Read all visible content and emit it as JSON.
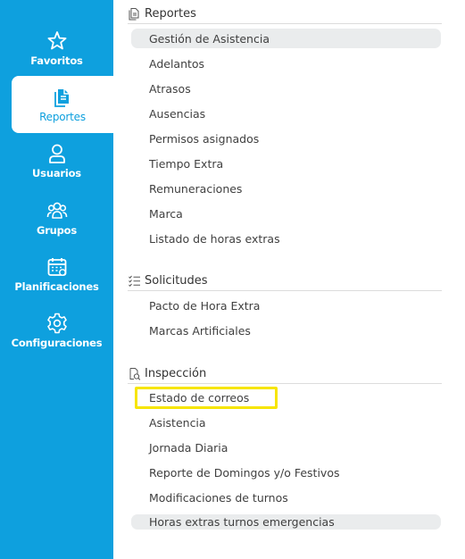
{
  "sidebar": {
    "items": [
      {
        "label": "Favoritos",
        "icon": "star-icon"
      },
      {
        "label": "Reportes",
        "icon": "document-icon",
        "active": true
      },
      {
        "label": "Usuarios",
        "icon": "user-icon"
      },
      {
        "label": "Grupos",
        "icon": "group-icon"
      },
      {
        "label": "Planificaciones",
        "icon": "calendar-icon"
      },
      {
        "label": "Configuraciones",
        "icon": "gear-icon"
      }
    ]
  },
  "sections": {
    "reportes": {
      "title": "Reportes",
      "icon": "document-icon",
      "items": [
        "Gestión de Asistencia",
        "Adelantos",
        "Atrasos",
        "Ausencias",
        "Permisos asignados",
        "Tiempo Extra",
        "Remuneraciones",
        "Marca",
        "Listado de horas extras"
      ]
    },
    "solicitudes": {
      "title": "Solicitudes",
      "icon": "checklist-icon",
      "items": [
        "Pacto de Hora Extra",
        "Marcas Artificiales"
      ]
    },
    "inspeccion": {
      "title": "Inspección",
      "icon": "inspection-icon",
      "items": [
        "Estado de correos",
        "Asistencia",
        "Jornada Diaria",
        "Reporte de Domingos y/o Festivos",
        "Modificaciones de turnos",
        "Horas extras turnos emergencias"
      ]
    }
  },
  "colors": {
    "sidebar_bg": "#0ea0de",
    "highlight_bg": "#eaeced",
    "focus_outline": "#f7e500"
  }
}
